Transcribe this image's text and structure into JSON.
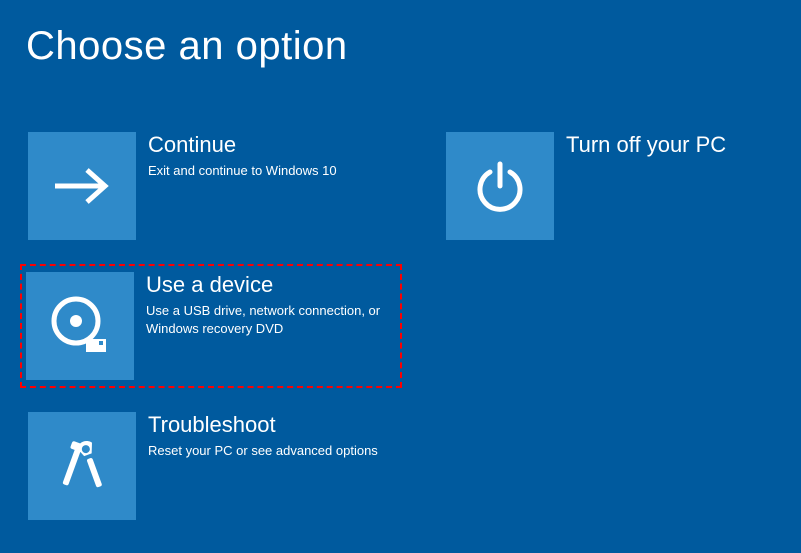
{
  "title": "Choose an option",
  "options": {
    "continue": {
      "title": "Continue",
      "desc": "Exit and continue to Windows 10"
    },
    "use_device": {
      "title": "Use a device",
      "desc": "Use a USB drive, network connection, or Windows recovery DVD"
    },
    "troubleshoot": {
      "title": "Troubleshoot",
      "desc": "Reset your PC or see advanced options"
    },
    "turn_off": {
      "title": "Turn off your PC"
    }
  }
}
